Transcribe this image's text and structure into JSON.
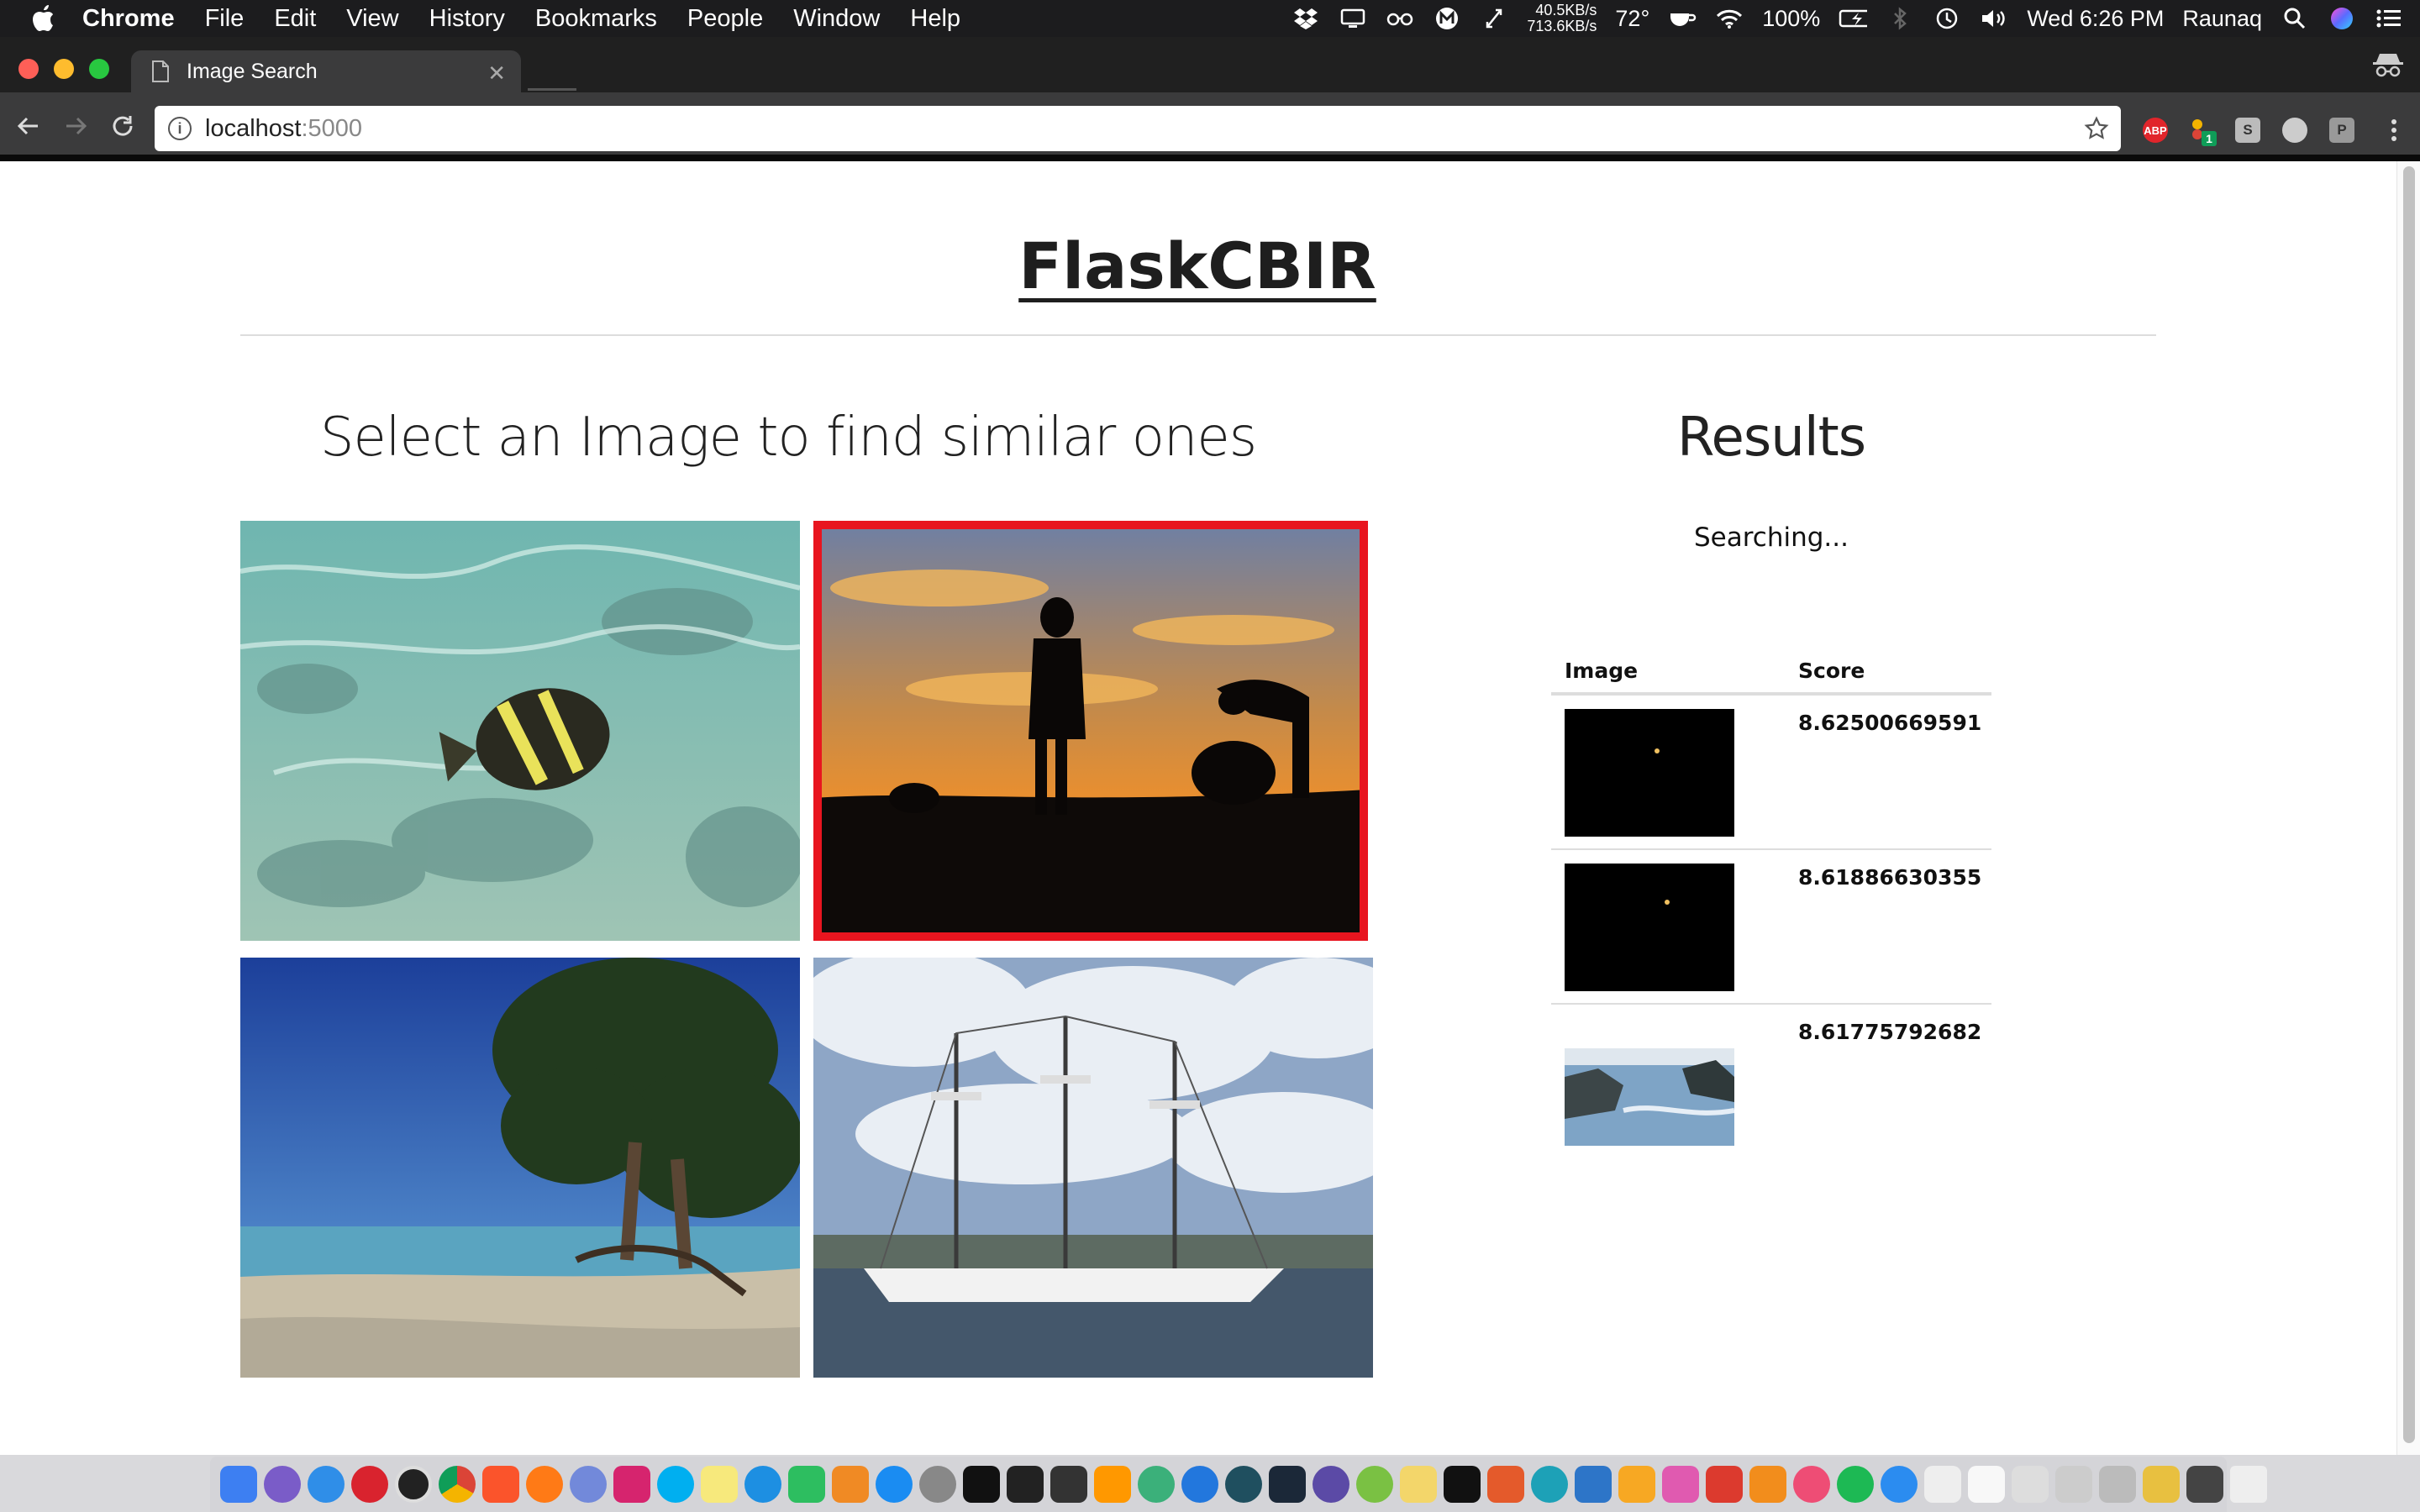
{
  "menubar": {
    "app_name": "Chrome",
    "items": [
      "File",
      "Edit",
      "View",
      "History",
      "Bookmarks",
      "People",
      "Window",
      "Help"
    ],
    "net_up": "40.5KB/s",
    "net_down": "713.6KB/s",
    "temperature": "72°",
    "battery": "100%",
    "datetime": "Wed 6:26 PM",
    "user": "Raunaq"
  },
  "browser": {
    "tab_title": "Image Search",
    "url_host": "localhost",
    "url_port": ":5000",
    "extensions": [
      "ABP",
      "1",
      "S",
      "P"
    ]
  },
  "page": {
    "site_title": "FlaskCBIR",
    "select_heading": "Select an Image to find similar ones",
    "results_heading": "Results",
    "status": "Searching...",
    "gallery": [
      {
        "name": "fish-underwater",
        "selected": false
      },
      {
        "name": "sunset-silhouettes",
        "selected": true
      },
      {
        "name": "beach-tree",
        "selected": false
      },
      {
        "name": "tall-ship-harbor",
        "selected": false
      }
    ],
    "results_table": {
      "headers": {
        "image": "Image",
        "score": "Score"
      },
      "rows": [
        {
          "image": "dark-night-image",
          "score": "8.62500669591"
        },
        {
          "image": "dark-night-image-2",
          "score": "8.61886630355"
        },
        {
          "image": "rocky-coast",
          "score": "8.61775792682"
        }
      ]
    }
  },
  "colors": {
    "selected_border": "#e8151f",
    "title_text": "#1e1e1e"
  }
}
